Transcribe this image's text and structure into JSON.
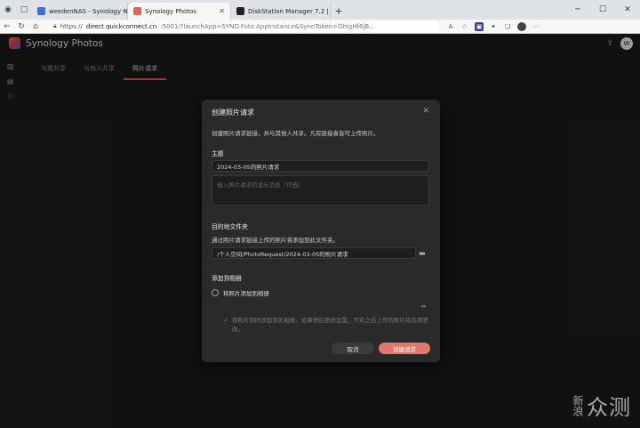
{
  "browser": {
    "tabs": [
      {
        "label": "weedenNAS - Synology NAS",
        "favicon_color": "#3b6fd8"
      },
      {
        "label": "Synology Photos",
        "favicon_color": "#e2624a"
      },
      {
        "label": "DiskStation Manager 7.2 | 數據…",
        "favicon_color": "#222222"
      }
    ],
    "new_tab": "+",
    "url_prefix": "https://",
    "url_host": "direct.quickconnect.cn",
    "url_rest": ":5001/?launchApp=SYNO.Foto.AppInstance&SynoToken=GhlgHf6jB…"
  },
  "app": {
    "title": "Synology Photos",
    "avatar": "W",
    "tabs": [
      "与我共享",
      "与他人共享",
      "照片请求"
    ],
    "active_tab": 2
  },
  "dialog": {
    "title": "创建照片请求",
    "description": "创建照片请求链接，并与其他人共享。凡有链接者皆可上传照片。",
    "subject_label": "主题",
    "subject_value": "2024-03-05的照片请求",
    "message_placeholder": "输入照片请求的显示消息（可选）",
    "dest_label": "目的地文件夹",
    "dest_desc": "通过照片请求链接上传的照片将添加到此文件夹。",
    "dest_value": "/个人空间/PhotoRequest/2024-03-05的照片请求",
    "album_label": "添加到相册",
    "album_option": "将照片添加到相册",
    "note": "将照片同时添加到此相册。如果稍后更改设置，只有之后上传的照片将应用更改。",
    "cancel": "取消",
    "create": "创建请求"
  },
  "watermark": {
    "line1": "新浪",
    "line2": "众测"
  }
}
